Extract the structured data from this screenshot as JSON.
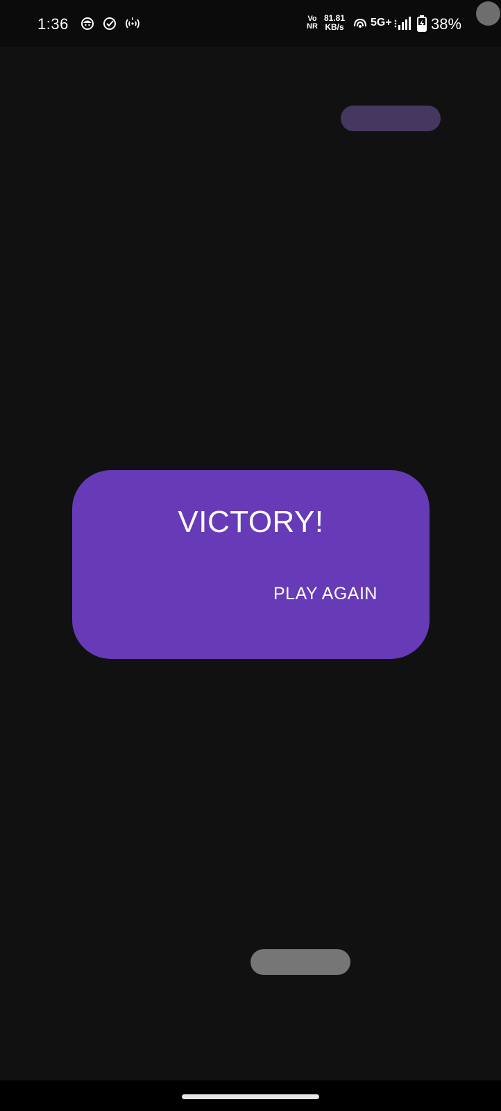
{
  "status_bar": {
    "time": "1:36",
    "notification_icons": [
      "app-face-icon",
      "check-circle-icon",
      "hotspot-broadcast-icon"
    ],
    "network_type_top": "Vo",
    "network_type_bottom": "NR",
    "speed_value": "81.81",
    "speed_unit": "KB/s",
    "wifi_calling_icon": "nfc-signal-icon",
    "cellular_label": "5G+",
    "signal_icon": "signal-bars-icon",
    "battery_icon": "battery-charging-icon",
    "battery_percent": "38%"
  },
  "game": {
    "result_title": "VICTORY!",
    "play_again_label": "PLAY AGAIN",
    "colors": {
      "background": "#111111",
      "card": "#673ab7",
      "enemy_paddle": "#463761",
      "player_paddle": "#767676"
    }
  }
}
